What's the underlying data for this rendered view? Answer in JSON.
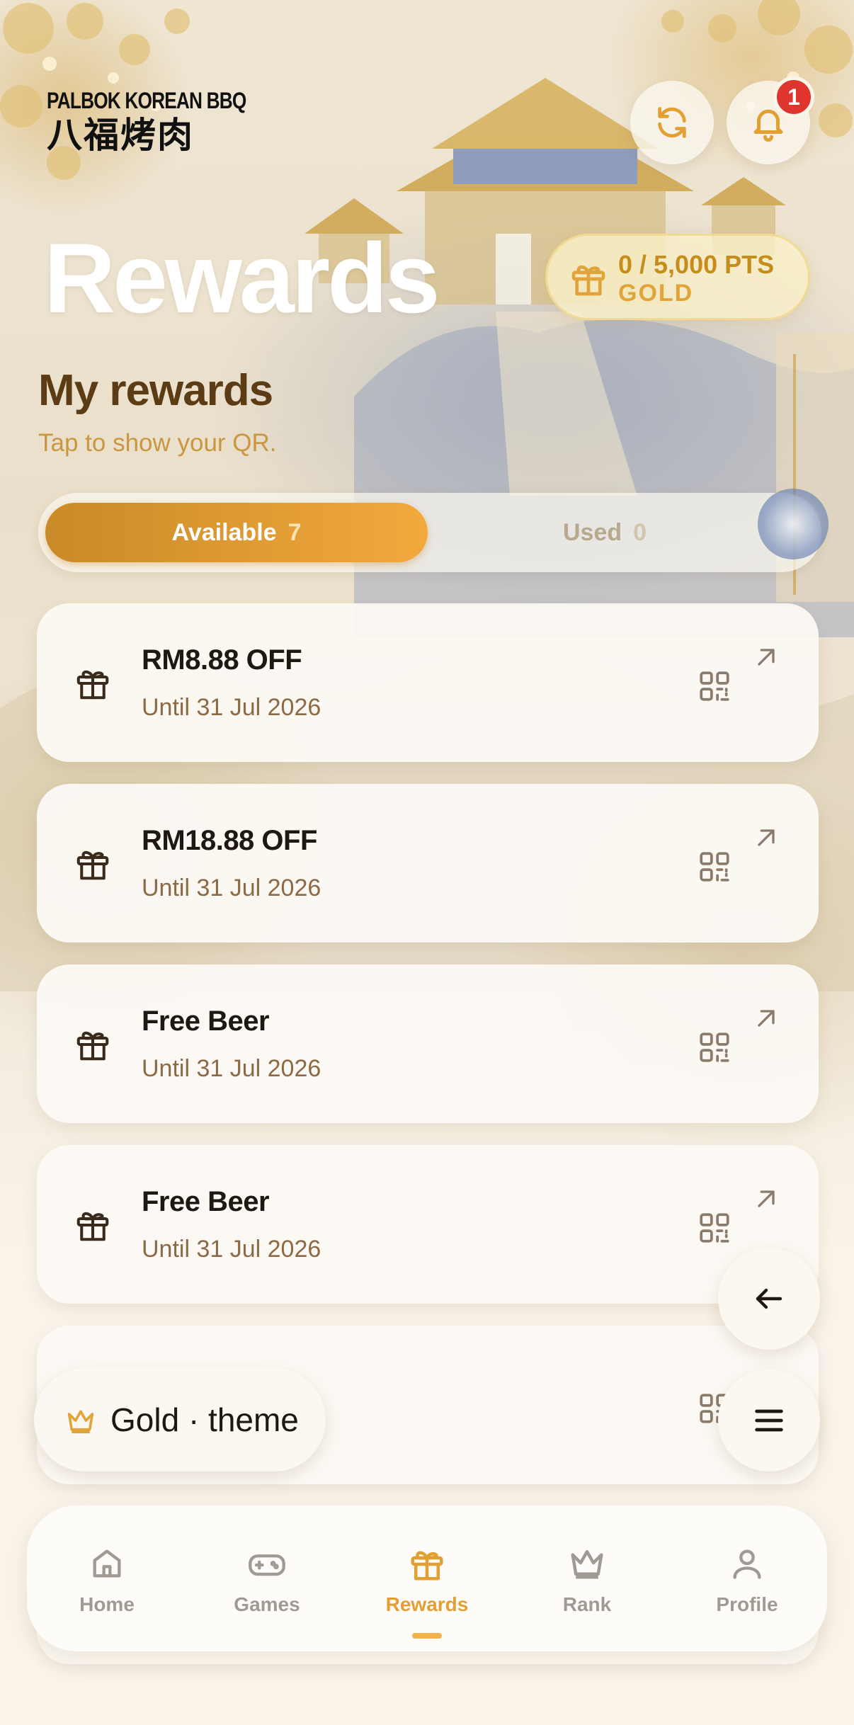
{
  "brand": {
    "name_en": "PALBOK KOREAN BBQ",
    "name_cn": "八福烤肉"
  },
  "header": {
    "notification_count": "1",
    "refresh_icon": "refresh-icon",
    "bell_icon": "bell-icon"
  },
  "page": {
    "title": "Rewards",
    "points_line": "0 / 5,000 PTS",
    "tier": "GOLD"
  },
  "section": {
    "title": "My rewards",
    "subtitle": "Tap to show your QR."
  },
  "tabs": [
    {
      "label": "Available",
      "count": "7",
      "active": true
    },
    {
      "label": "Used",
      "count": "0",
      "active": false
    }
  ],
  "rewards": [
    {
      "title": "RM8.88 OFF",
      "expiry": "Until 31 Jul 2026"
    },
    {
      "title": "RM18.88 OFF",
      "expiry": "Until 31 Jul 2026"
    },
    {
      "title": "Free Beer",
      "expiry": "Until 31 Jul 2026"
    },
    {
      "title": "Free Beer",
      "expiry": "Until 31 Jul 2026"
    }
  ],
  "theme_pill": {
    "label": "Gold · theme"
  },
  "bottom_nav": [
    {
      "label": "Home",
      "icon": "home-icon",
      "active": false
    },
    {
      "label": "Games",
      "icon": "gamepad-icon",
      "active": false
    },
    {
      "label": "Rewards",
      "icon": "gift-icon",
      "active": true
    },
    {
      "label": "Rank",
      "icon": "crown-icon",
      "active": false
    },
    {
      "label": "Profile",
      "icon": "user-icon",
      "active": false
    }
  ],
  "colors": {
    "accent": "#f0b34a",
    "accent_dark": "#c98a28",
    "heading_brown": "#5c3c14",
    "subtitle_gold": "#c9973f",
    "badge_red": "#e0352f"
  }
}
